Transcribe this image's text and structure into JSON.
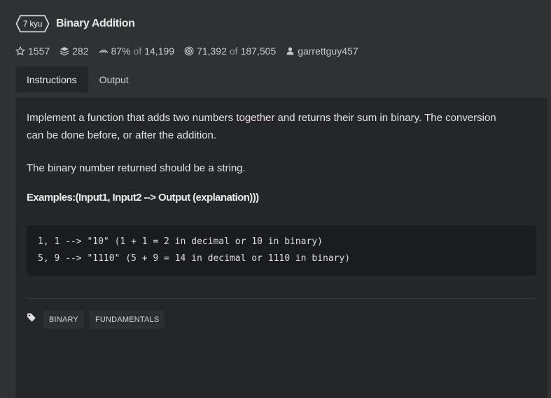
{
  "kata": {
    "rank": "7 kyu",
    "title": "Binary Addition"
  },
  "stats": {
    "stars": "1557",
    "collections": "282",
    "satisfaction_percent": "87%",
    "satisfaction_of": "of",
    "satisfaction_votes": "14,199",
    "completions": "71,392",
    "completions_of": "of",
    "attempts": "187,505",
    "author": "garrettguy457"
  },
  "tabs": [
    {
      "label": "Instructions",
      "active": true
    },
    {
      "label": "Output",
      "active": false
    }
  ],
  "description": {
    "paragraph1_line1": "Implement a function that adds two numbers together and returns their sum in binary. The conversion",
    "paragraph1_line2": "can be done before, or after the addition.",
    "paragraph2": "The binary number returned should be a string.",
    "examples_heading": "Examples:(Input1, Input2 --> Output (explanation)))",
    "code_lines": [
      "1, 1 --> \"10\" (1 + 1 = 2 in decimal or 10 in binary)",
      "5, 9 --> \"1110\" (5 + 9 = 14 in decimal or 1110 in binary)"
    ]
  },
  "tags": [
    "BINARY",
    "FUNDAMENTALS"
  ],
  "colors": {
    "background": "#303133",
    "panel": "#25262a",
    "code_background": "#1b1c1e",
    "text": "#e4e4e4"
  },
  "icons": {
    "rank": "hexagon-badge-icon",
    "stars": "star-outline-icon",
    "collections": "stack-layers-icon",
    "satisfaction": "eye-rainbow-icon",
    "completions": "target-bullseye-icon",
    "author": "user-icon",
    "tags": "tag-icon"
  }
}
